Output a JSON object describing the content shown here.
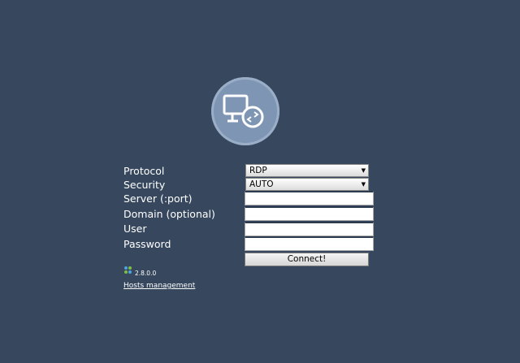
{
  "form": {
    "protocol": {
      "label": "Protocol",
      "value": "RDP"
    },
    "security": {
      "label": "Security",
      "value": "AUTO"
    },
    "server": {
      "label": "Server (:port)",
      "value": ""
    },
    "domain": {
      "label": "Domain (optional)",
      "value": ""
    },
    "user": {
      "label": "User",
      "value": ""
    },
    "password": {
      "label": "Password",
      "value": ""
    },
    "connect_label": "Connect!"
  },
  "footer": {
    "version": "2.8.0.0",
    "hosts_link": "Hosts management"
  },
  "icons": {
    "logo": "remote-desktop-icon",
    "version": "app-version-icon",
    "dropdown": "dropdown-arrow-icon"
  },
  "colors": {
    "background": "#36475e",
    "logo_circle": "#7e95b4",
    "label_text": "#ffffff"
  }
}
